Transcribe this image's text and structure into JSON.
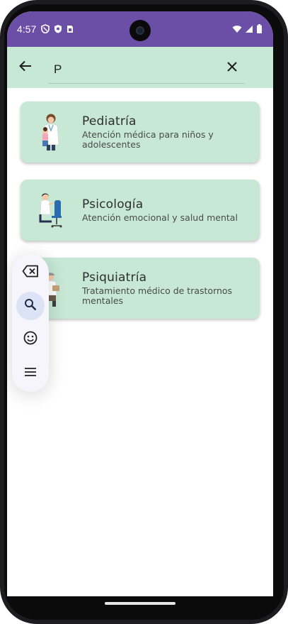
{
  "status_bar": {
    "time": "4:57",
    "bg_color": "#6b4fa7",
    "left_icons": [
      "shield-icon",
      "play-protect-icon",
      "sim-card-icon"
    ],
    "right_icons": [
      "wifi-icon",
      "signal-icon",
      "battery-icon"
    ]
  },
  "search": {
    "value": "P",
    "back_icon": "arrow-left-icon",
    "clear_icon": "close-icon",
    "bg_color": "#c6e8d5"
  },
  "results": [
    {
      "title": "Pediatría",
      "description": "Atención médica para niños y adolescentes",
      "image": "pediatrician-illustration"
    },
    {
      "title": "Psicología",
      "description": "Atención emocional y salud mental",
      "image": "psychologist-illustration"
    },
    {
      "title": "Psiquiatría",
      "description": "Tratamiento médico de trastornos mentales",
      "image": "psychiatrist-illustration"
    }
  ],
  "keyboard_toolbar": {
    "items": [
      "backspace-icon",
      "search-icon",
      "emoji-icon",
      "menu-icon"
    ],
    "active": "search-icon"
  },
  "colors": {
    "card": "#c6e8d5",
    "accent": "#6b4fa7"
  }
}
